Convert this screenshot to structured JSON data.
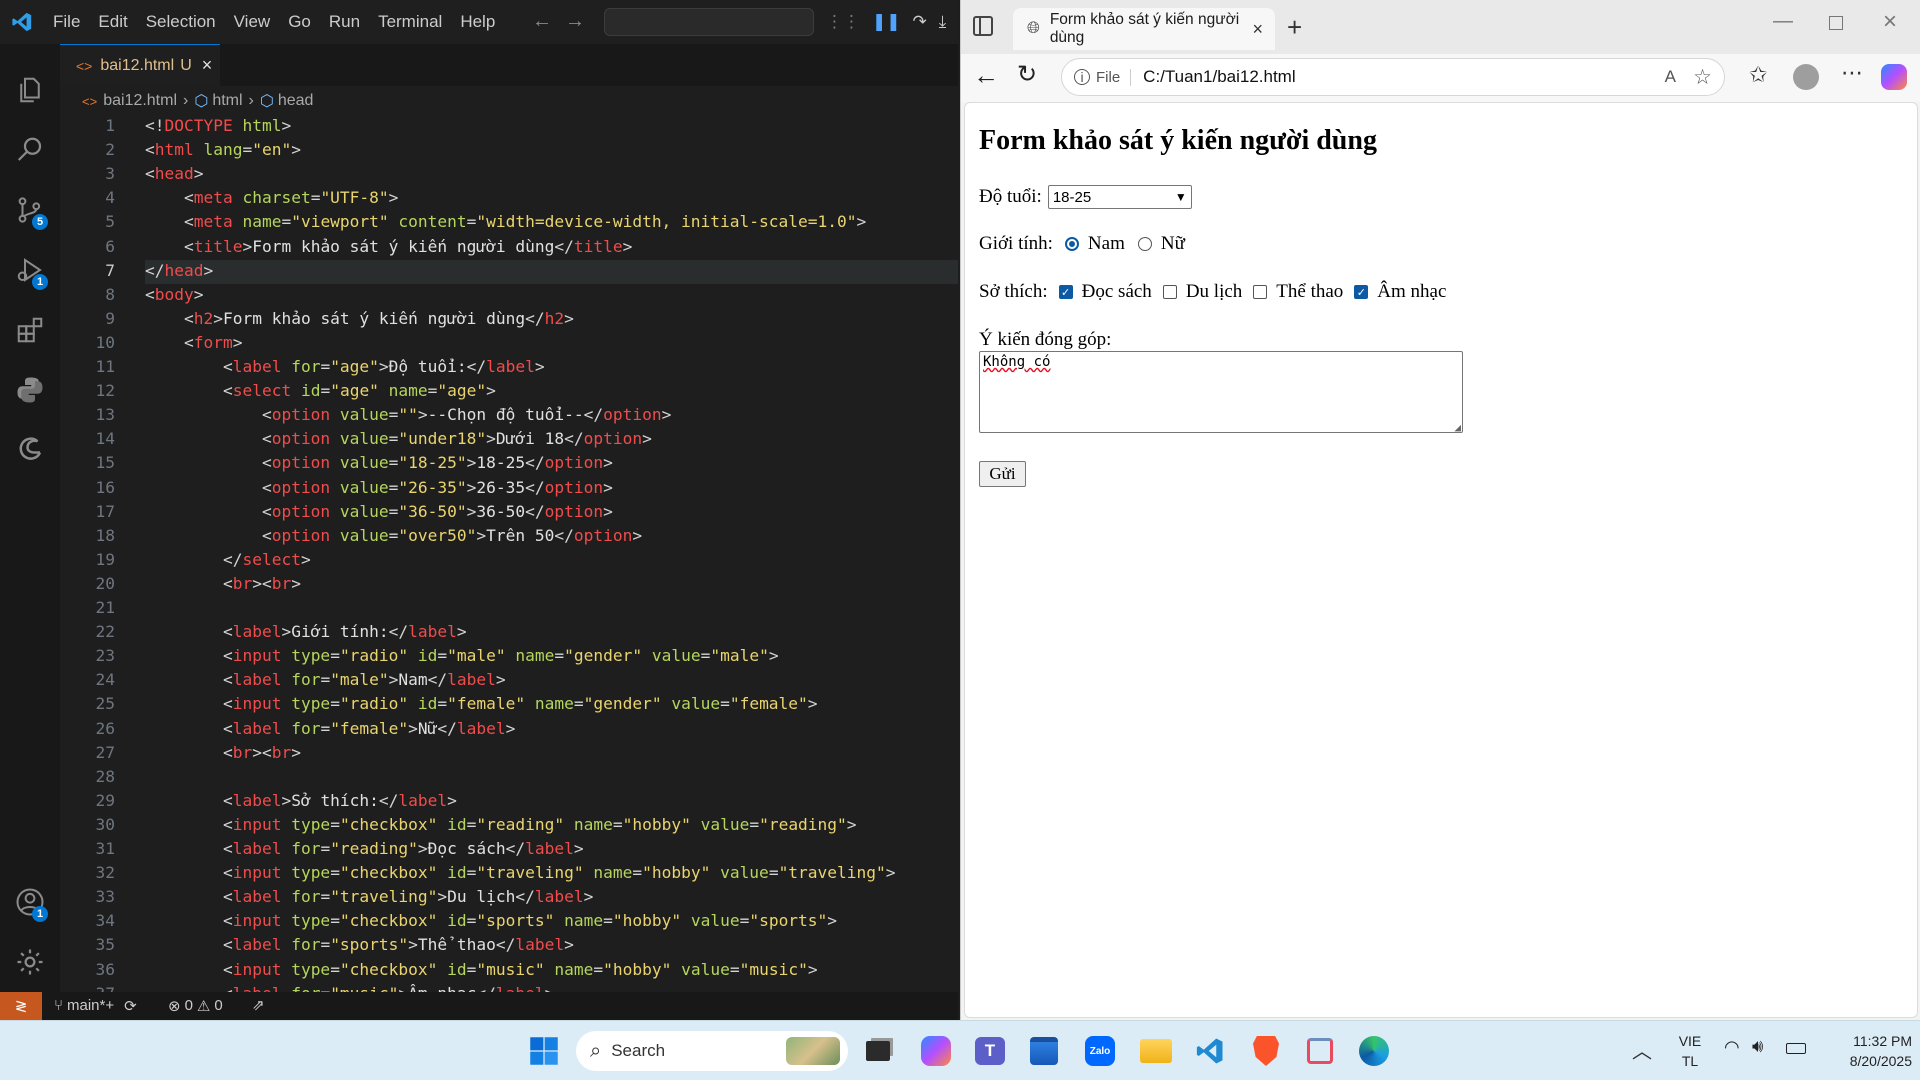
{
  "vscode": {
    "menu": [
      "File",
      "Edit",
      "Selection",
      "View",
      "Go",
      "Run",
      "Terminal",
      "Help"
    ],
    "tab": {
      "name": "bai12.html",
      "status": "U"
    },
    "breadcrumb": [
      "bai12.html",
      "html",
      "head"
    ],
    "badges": {
      "scm": "5",
      "debug": "1",
      "accounts": "1"
    },
    "code_lines": [
      [
        [
          "pu",
          "<!"
        ],
        [
          "tg",
          "DOCTYPE"
        ],
        [
          "at",
          " html"
        ],
        [
          "pu",
          ">"
        ]
      ],
      [
        [
          "pu",
          "<"
        ],
        [
          "tg",
          "html"
        ],
        [
          "at",
          " lang"
        ],
        [
          "pu",
          "="
        ],
        [
          "st",
          "\"en\""
        ],
        [
          "pu",
          ">"
        ]
      ],
      [
        [
          "pu",
          "<"
        ],
        [
          "tg",
          "head"
        ],
        [
          "pu",
          ">"
        ]
      ],
      [
        [
          "pu",
          "    <"
        ],
        [
          "tg",
          "meta"
        ],
        [
          "at",
          " charset"
        ],
        [
          "pu",
          "="
        ],
        [
          "st",
          "\"UTF-8\""
        ],
        [
          "pu",
          ">"
        ]
      ],
      [
        [
          "pu",
          "    <"
        ],
        [
          "tg",
          "meta"
        ],
        [
          "at",
          " name"
        ],
        [
          "pu",
          "="
        ],
        [
          "st",
          "\"viewport\""
        ],
        [
          "at",
          " content"
        ],
        [
          "pu",
          "="
        ],
        [
          "st",
          "\"width=device-width, initial-scale=1.0\""
        ],
        [
          "pu",
          ">"
        ]
      ],
      [
        [
          "pu",
          "    <"
        ],
        [
          "tg",
          "title"
        ],
        [
          "pu",
          ">"
        ],
        [
          "tx",
          "Form khảo sát ý kiến người dùng"
        ],
        [
          "pu",
          "</"
        ],
        [
          "tg",
          "title"
        ],
        [
          "pu",
          ">"
        ]
      ],
      [
        [
          "pu",
          "</"
        ],
        [
          "tg",
          "head"
        ],
        [
          "pu",
          ">"
        ]
      ],
      [
        [
          "pu",
          "<"
        ],
        [
          "tg",
          "body"
        ],
        [
          "pu",
          ">"
        ]
      ],
      [
        [
          "pu",
          "    <"
        ],
        [
          "tg",
          "h2"
        ],
        [
          "pu",
          ">"
        ],
        [
          "tx",
          "Form khảo sát ý kiến người dùng"
        ],
        [
          "pu",
          "</"
        ],
        [
          "tg",
          "h2"
        ],
        [
          "pu",
          ">"
        ]
      ],
      [
        [
          "pu",
          "    <"
        ],
        [
          "tg",
          "form"
        ],
        [
          "pu",
          ">"
        ]
      ],
      [
        [
          "pu",
          "        <"
        ],
        [
          "tg",
          "label"
        ],
        [
          "at",
          " for"
        ],
        [
          "pu",
          "="
        ],
        [
          "st",
          "\"age\""
        ],
        [
          "pu",
          ">"
        ],
        [
          "tx",
          "Độ tuổi:"
        ],
        [
          "pu",
          "</"
        ],
        [
          "tg",
          "label"
        ],
        [
          "pu",
          ">"
        ]
      ],
      [
        [
          "pu",
          "        <"
        ],
        [
          "tg",
          "select"
        ],
        [
          "at",
          " id"
        ],
        [
          "pu",
          "="
        ],
        [
          "st",
          "\"age\""
        ],
        [
          "at",
          " name"
        ],
        [
          "pu",
          "="
        ],
        [
          "st",
          "\"age\""
        ],
        [
          "pu",
          ">"
        ]
      ],
      [
        [
          "pu",
          "            <"
        ],
        [
          "tg",
          "option"
        ],
        [
          "at",
          " value"
        ],
        [
          "pu",
          "="
        ],
        [
          "st",
          "\"\""
        ],
        [
          "pu",
          ">"
        ],
        [
          "tx",
          "--Chọn độ tuổi--"
        ],
        [
          "pu",
          "</"
        ],
        [
          "tg",
          "option"
        ],
        [
          "pu",
          ">"
        ]
      ],
      [
        [
          "pu",
          "            <"
        ],
        [
          "tg",
          "option"
        ],
        [
          "at",
          " value"
        ],
        [
          "pu",
          "="
        ],
        [
          "st",
          "\"under18\""
        ],
        [
          "pu",
          ">"
        ],
        [
          "tx",
          "Dưới 18"
        ],
        [
          "pu",
          "</"
        ],
        [
          "tg",
          "option"
        ],
        [
          "pu",
          ">"
        ]
      ],
      [
        [
          "pu",
          "            <"
        ],
        [
          "tg",
          "option"
        ],
        [
          "at",
          " value"
        ],
        [
          "pu",
          "="
        ],
        [
          "st",
          "\"18-25\""
        ],
        [
          "pu",
          ">"
        ],
        [
          "tx",
          "18-25"
        ],
        [
          "pu",
          "</"
        ],
        [
          "tg",
          "option"
        ],
        [
          "pu",
          ">"
        ]
      ],
      [
        [
          "pu",
          "            <"
        ],
        [
          "tg",
          "option"
        ],
        [
          "at",
          " value"
        ],
        [
          "pu",
          "="
        ],
        [
          "st",
          "\"26-35\""
        ],
        [
          "pu",
          ">"
        ],
        [
          "tx",
          "26-35"
        ],
        [
          "pu",
          "</"
        ],
        [
          "tg",
          "option"
        ],
        [
          "pu",
          ">"
        ]
      ],
      [
        [
          "pu",
          "            <"
        ],
        [
          "tg",
          "option"
        ],
        [
          "at",
          " value"
        ],
        [
          "pu",
          "="
        ],
        [
          "st",
          "\"36-50\""
        ],
        [
          "pu",
          ">"
        ],
        [
          "tx",
          "36-50"
        ],
        [
          "pu",
          "</"
        ],
        [
          "tg",
          "option"
        ],
        [
          "pu",
          ">"
        ]
      ],
      [
        [
          "pu",
          "            <"
        ],
        [
          "tg",
          "option"
        ],
        [
          "at",
          " value"
        ],
        [
          "pu",
          "="
        ],
        [
          "st",
          "\"over50\""
        ],
        [
          "pu",
          ">"
        ],
        [
          "tx",
          "Trên 50"
        ],
        [
          "pu",
          "</"
        ],
        [
          "tg",
          "option"
        ],
        [
          "pu",
          ">"
        ]
      ],
      [
        [
          "pu",
          "        </"
        ],
        [
          "tg",
          "select"
        ],
        [
          "pu",
          ">"
        ]
      ],
      [
        [
          "pu",
          "        <"
        ],
        [
          "tg",
          "br"
        ],
        [
          "pu",
          "><"
        ],
        [
          "tg",
          "br"
        ],
        [
          "pu",
          ">"
        ]
      ],
      [],
      [
        [
          "pu",
          "        <"
        ],
        [
          "tg",
          "label"
        ],
        [
          "pu",
          ">"
        ],
        [
          "tx",
          "Giới tính:"
        ],
        [
          "pu",
          "</"
        ],
        [
          "tg",
          "label"
        ],
        [
          "pu",
          ">"
        ]
      ],
      [
        [
          "pu",
          "        <"
        ],
        [
          "tg",
          "input"
        ],
        [
          "at",
          " type"
        ],
        [
          "pu",
          "="
        ],
        [
          "st",
          "\"radio\""
        ],
        [
          "at",
          " id"
        ],
        [
          "pu",
          "="
        ],
        [
          "st",
          "\"male\""
        ],
        [
          "at",
          " name"
        ],
        [
          "pu",
          "="
        ],
        [
          "st",
          "\"gender\""
        ],
        [
          "at",
          " value"
        ],
        [
          "pu",
          "="
        ],
        [
          "st",
          "\"male\""
        ],
        [
          "pu",
          ">"
        ]
      ],
      [
        [
          "pu",
          "        <"
        ],
        [
          "tg",
          "label"
        ],
        [
          "at",
          " for"
        ],
        [
          "pu",
          "="
        ],
        [
          "st",
          "\"male\""
        ],
        [
          "pu",
          ">"
        ],
        [
          "tx",
          "Nam"
        ],
        [
          "pu",
          "</"
        ],
        [
          "tg",
          "label"
        ],
        [
          "pu",
          ">"
        ]
      ],
      [
        [
          "pu",
          "        <"
        ],
        [
          "tg",
          "input"
        ],
        [
          "at",
          " type"
        ],
        [
          "pu",
          "="
        ],
        [
          "st",
          "\"radio\""
        ],
        [
          "at",
          " id"
        ],
        [
          "pu",
          "="
        ],
        [
          "st",
          "\"female\""
        ],
        [
          "at",
          " name"
        ],
        [
          "pu",
          "="
        ],
        [
          "st",
          "\"gender\""
        ],
        [
          "at",
          " value"
        ],
        [
          "pu",
          "="
        ],
        [
          "st",
          "\"female\""
        ],
        [
          "pu",
          ">"
        ]
      ],
      [
        [
          "pu",
          "        <"
        ],
        [
          "tg",
          "label"
        ],
        [
          "at",
          " for"
        ],
        [
          "pu",
          "="
        ],
        [
          "st",
          "\"female\""
        ],
        [
          "pu",
          ">"
        ],
        [
          "tx",
          "Nữ"
        ],
        [
          "pu",
          "</"
        ],
        [
          "tg",
          "label"
        ],
        [
          "pu",
          ">"
        ]
      ],
      [
        [
          "pu",
          "        <"
        ],
        [
          "tg",
          "br"
        ],
        [
          "pu",
          "><"
        ],
        [
          "tg",
          "br"
        ],
        [
          "pu",
          ">"
        ]
      ],
      [],
      [
        [
          "pu",
          "        <"
        ],
        [
          "tg",
          "label"
        ],
        [
          "pu",
          ">"
        ],
        [
          "tx",
          "Sở thích:"
        ],
        [
          "pu",
          "</"
        ],
        [
          "tg",
          "label"
        ],
        [
          "pu",
          ">"
        ]
      ],
      [
        [
          "pu",
          "        <"
        ],
        [
          "tg",
          "input"
        ],
        [
          "at",
          " type"
        ],
        [
          "pu",
          "="
        ],
        [
          "st",
          "\"checkbox\""
        ],
        [
          "at",
          " id"
        ],
        [
          "pu",
          "="
        ],
        [
          "st",
          "\"reading\""
        ],
        [
          "at",
          " name"
        ],
        [
          "pu",
          "="
        ],
        [
          "st",
          "\"hobby\""
        ],
        [
          "at",
          " value"
        ],
        [
          "pu",
          "="
        ],
        [
          "st",
          "\"reading\""
        ],
        [
          "pu",
          ">"
        ]
      ],
      [
        [
          "pu",
          "        <"
        ],
        [
          "tg",
          "label"
        ],
        [
          "at",
          " for"
        ],
        [
          "pu",
          "="
        ],
        [
          "st",
          "\"reading\""
        ],
        [
          "pu",
          ">"
        ],
        [
          "tx",
          "Đọc sách"
        ],
        [
          "pu",
          "</"
        ],
        [
          "tg",
          "label"
        ],
        [
          "pu",
          ">"
        ]
      ],
      [
        [
          "pu",
          "        <"
        ],
        [
          "tg",
          "input"
        ],
        [
          "at",
          " type"
        ],
        [
          "pu",
          "="
        ],
        [
          "st",
          "\"checkbox\""
        ],
        [
          "at",
          " id"
        ],
        [
          "pu",
          "="
        ],
        [
          "st",
          "\"traveling\""
        ],
        [
          "at",
          " name"
        ],
        [
          "pu",
          "="
        ],
        [
          "st",
          "\"hobby\""
        ],
        [
          "at",
          " value"
        ],
        [
          "pu",
          "="
        ],
        [
          "st",
          "\"traveling\""
        ],
        [
          "pu",
          ">"
        ]
      ],
      [
        [
          "pu",
          "        <"
        ],
        [
          "tg",
          "label"
        ],
        [
          "at",
          " for"
        ],
        [
          "pu",
          "="
        ],
        [
          "st",
          "\"traveling\""
        ],
        [
          "pu",
          ">"
        ],
        [
          "tx",
          "Du lịch"
        ],
        [
          "pu",
          "</"
        ],
        [
          "tg",
          "label"
        ],
        [
          "pu",
          ">"
        ]
      ],
      [
        [
          "pu",
          "        <"
        ],
        [
          "tg",
          "input"
        ],
        [
          "at",
          " type"
        ],
        [
          "pu",
          "="
        ],
        [
          "st",
          "\"checkbox\""
        ],
        [
          "at",
          " id"
        ],
        [
          "pu",
          "="
        ],
        [
          "st",
          "\"sports\""
        ],
        [
          "at",
          " name"
        ],
        [
          "pu",
          "="
        ],
        [
          "st",
          "\"hobby\""
        ],
        [
          "at",
          " value"
        ],
        [
          "pu",
          "="
        ],
        [
          "st",
          "\"sports\""
        ],
        [
          "pu",
          ">"
        ]
      ],
      [
        [
          "pu",
          "        <"
        ],
        [
          "tg",
          "label"
        ],
        [
          "at",
          " for"
        ],
        [
          "pu",
          "="
        ],
        [
          "st",
          "\"sports\""
        ],
        [
          "pu",
          ">"
        ],
        [
          "tx",
          "Thể thao"
        ],
        [
          "pu",
          "</"
        ],
        [
          "tg",
          "label"
        ],
        [
          "pu",
          ">"
        ]
      ],
      [
        [
          "pu",
          "        <"
        ],
        [
          "tg",
          "input"
        ],
        [
          "at",
          " type"
        ],
        [
          "pu",
          "="
        ],
        [
          "st",
          "\"checkbox\""
        ],
        [
          "at",
          " id"
        ],
        [
          "pu",
          "="
        ],
        [
          "st",
          "\"music\""
        ],
        [
          "at",
          " name"
        ],
        [
          "pu",
          "="
        ],
        [
          "st",
          "\"hobby\""
        ],
        [
          "at",
          " value"
        ],
        [
          "pu",
          "="
        ],
        [
          "st",
          "\"music\""
        ],
        [
          "pu",
          ">"
        ]
      ],
      [
        [
          "pu",
          "        <"
        ],
        [
          "tg",
          "label"
        ],
        [
          "at",
          " for"
        ],
        [
          "pu",
          "="
        ],
        [
          "st",
          "\"music\""
        ],
        [
          "pu",
          ">"
        ],
        [
          "tx",
          "Âm nhạc"
        ],
        [
          "pu",
          "</"
        ],
        [
          "tg",
          "label"
        ],
        [
          "pu",
          ">"
        ]
      ]
    ],
    "status": {
      "branch": "main*+",
      "errors": "0",
      "warnings": "0"
    }
  },
  "browser": {
    "tab_title": "Form khảo sát ý kiến người dùng",
    "address_scheme": "File",
    "address_url": "C:/Tuan1/bai12.html",
    "page": {
      "heading": "Form khảo sát ý kiến người dùng",
      "age_label": "Độ tuổi:",
      "age_selected": "18-25",
      "gender_label": "Giới tính:",
      "gender_options": [
        {
          "label": "Nam",
          "checked": true
        },
        {
          "label": "Nữ",
          "checked": false
        }
      ],
      "hobby_label": "Sở thích:",
      "hobby_options": [
        {
          "label": "Đọc sách",
          "checked": true
        },
        {
          "label": "Du lịch",
          "checked": false
        },
        {
          "label": "Thể thao",
          "checked": false
        },
        {
          "label": "Âm nhạc",
          "checked": true
        }
      ],
      "feedback_label": "Ý kiến đóng góp:",
      "feedback_value": "Không có",
      "submit_label": "Gửi"
    }
  },
  "taskbar": {
    "search_label": "Search",
    "lang": "VIE",
    "lang_sub": "TL",
    "time": "11:32 PM",
    "date": "8/20/2025"
  },
  "colors": {
    "vscode_accent": "#0078d4",
    "edge_accent": "#0c59a4",
    "taskbar": "#dcecf6"
  }
}
